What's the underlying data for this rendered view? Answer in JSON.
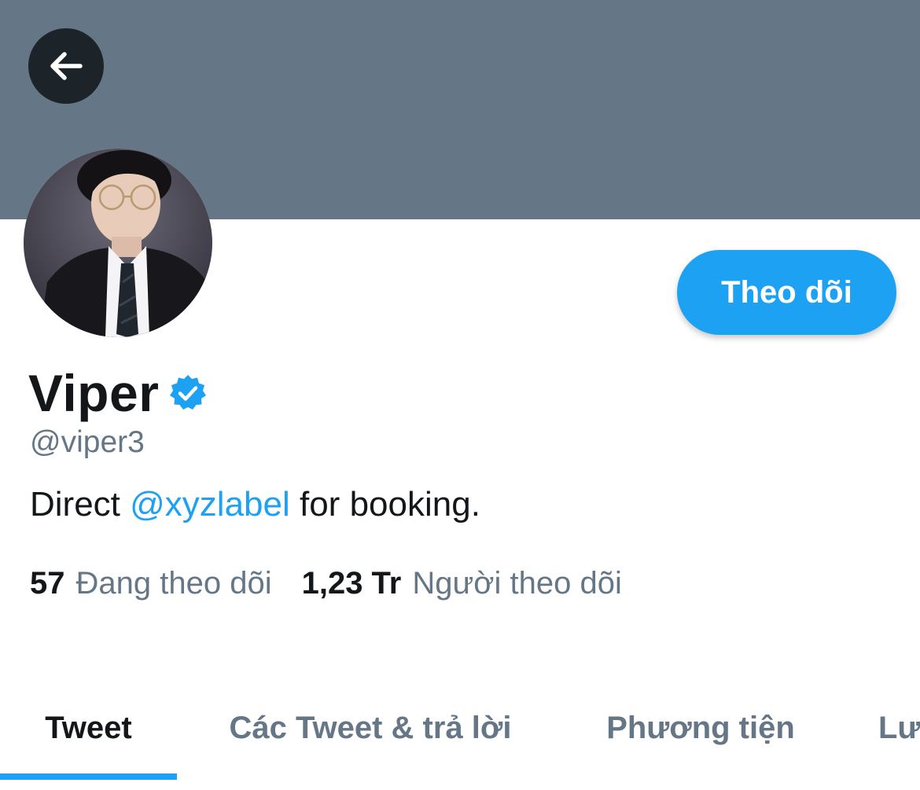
{
  "header": {
    "back_icon": "arrow-left-icon",
    "banner_color": "#657786"
  },
  "profile": {
    "avatar": "profile-photo",
    "name": "Viper",
    "verified_icon": "verified-badge-icon",
    "handle": "@viper3",
    "bio": {
      "prefix": "Direct ",
      "mention": "@xyzlabel",
      "suffix": " for booking."
    },
    "follow_button_label": "Theo dõi",
    "stats": {
      "following_count": "57",
      "following_label": "Đang theo dõi",
      "followers_count": "1,23 Tr",
      "followers_label": "Người theo dõi"
    }
  },
  "tabs": [
    {
      "label": "Tweet",
      "active": true
    },
    {
      "label": "Các Tweet & trả lời",
      "active": false
    },
    {
      "label": "Phương tiện",
      "active": false
    },
    {
      "label": "Lượt thích",
      "active": false
    }
  ],
  "colors": {
    "accent": "#1da1f2",
    "text_primary": "#14171a",
    "text_secondary": "#657786"
  }
}
